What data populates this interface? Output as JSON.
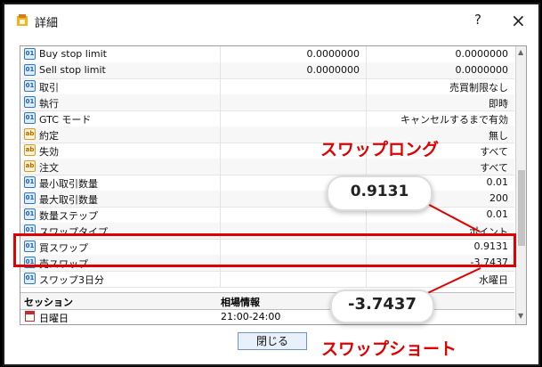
{
  "window": {
    "title": "詳細",
    "help": "?",
    "close": "×"
  },
  "rows": [
    {
      "name": "Buy stop limit",
      "v1": "0.0000000",
      "v2": "0.0000000"
    },
    {
      "name": "Sell stop limit",
      "v1": "0.0000000",
      "v2": "0.0000000"
    },
    {
      "name": "取引",
      "v1": "",
      "v2": "売買制限なし"
    },
    {
      "name": "執行",
      "v1": "",
      "v2": "即時"
    },
    {
      "name": "GTC モード",
      "v1": "",
      "v2": "キャンセルするまで有効"
    },
    {
      "name": "約定",
      "v1": "",
      "v2": "無し"
    },
    {
      "name": "失効",
      "v1": "",
      "v2": "すべて"
    },
    {
      "name": "注文",
      "v1": "",
      "v2": "すべて"
    },
    {
      "name": "最小取引数量",
      "v1": "",
      "v2": "0.01"
    },
    {
      "name": "最大取引数量",
      "v1": "",
      "v2": "200"
    },
    {
      "name": "数量ステップ",
      "v1": "",
      "v2": "0.01"
    },
    {
      "name": "スワップタイプ",
      "v1": "",
      "v2": "ポイント"
    },
    {
      "name": "買スワップ",
      "v1": "",
      "v2": "0.9131"
    },
    {
      "name": "売スワップ",
      "v1": "",
      "v2": "-3.7437"
    },
    {
      "name": "スワップ3日分",
      "v1": "",
      "v2": "水曜日"
    }
  ],
  "section": {
    "left": "セッション",
    "right": "相場情報"
  },
  "schedule": {
    "day": "日曜日",
    "time": "21:00-24:00"
  },
  "button": {
    "close": "閉じる"
  },
  "annotations": {
    "swap_long": "スワップロング",
    "swap_short": "スワップショート",
    "callout_long": "0.9131",
    "callout_short": "-3.7437"
  },
  "colors": {
    "annotation": "#e00000",
    "selected_button": "#6d93c9"
  }
}
